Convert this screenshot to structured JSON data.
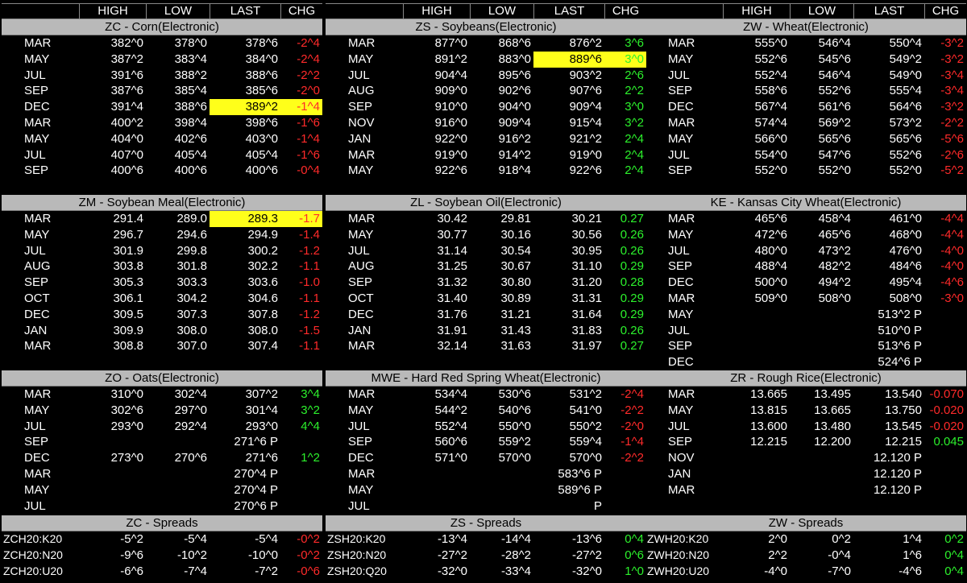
{
  "header": [
    "HIGH",
    "LOW",
    "LAST",
    "CHG"
  ],
  "colors": {
    "up": "#2cf02c",
    "down": "#ff2a2a",
    "highlight": "#ffff1a",
    "title_bg": "#b9b9b9"
  },
  "panels": [
    {
      "title": "ZC - Corn(Electronic)",
      "rows": [
        {
          "m": "MAR",
          "h": "382^0",
          "l": "378^0",
          "last": "378^6",
          "chg": "-2^4",
          "d": "down"
        },
        {
          "m": "MAY",
          "h": "387^2",
          "l": "383^4",
          "last": "384^0",
          "chg": "-2^4",
          "d": "down"
        },
        {
          "m": "JUL",
          "h": "391^6",
          "l": "388^2",
          "last": "388^6",
          "chg": "-2^2",
          "d": "down"
        },
        {
          "m": "SEP",
          "h": "387^6",
          "l": "385^4",
          "last": "385^6",
          "chg": "-2^0",
          "d": "down"
        },
        {
          "m": "DEC",
          "h": "391^4",
          "l": "388^6",
          "last": "389^2",
          "chg": "-1^4",
          "d": "down",
          "hl": true
        },
        {
          "m": "MAR",
          "h": "400^2",
          "l": "398^4",
          "last": "398^6",
          "chg": "-1^6",
          "d": "down"
        },
        {
          "m": "MAY",
          "h": "404^0",
          "l": "402^6",
          "last": "403^0",
          "chg": "-1^4",
          "d": "down"
        },
        {
          "m": "JUL",
          "h": "407^0",
          "l": "405^4",
          "last": "405^4",
          "chg": "-1^6",
          "d": "down"
        },
        {
          "m": "SEP",
          "h": "400^6",
          "l": "400^6",
          "last": "400^6",
          "chg": "-0^4",
          "d": "down"
        }
      ]
    },
    {
      "title": "ZS - Soybeans(Electronic)",
      "rows": [
        {
          "m": "MAR",
          "h": "877^0",
          "l": "868^6",
          "last": "876^2",
          "chg": "3^6",
          "d": "up"
        },
        {
          "m": "MAY",
          "h": "891^2",
          "l": "883^0",
          "last": "889^6",
          "chg": "3^0",
          "d": "up",
          "hl": true
        },
        {
          "m": "JUL",
          "h": "904^4",
          "l": "895^6",
          "last": "903^2",
          "chg": "2^6",
          "d": "up"
        },
        {
          "m": "AUG",
          "h": "909^0",
          "l": "902^6",
          "last": "907^6",
          "chg": "2^2",
          "d": "up"
        },
        {
          "m": "SEP",
          "h": "910^0",
          "l": "904^0",
          "last": "909^4",
          "chg": "3^0",
          "d": "up"
        },
        {
          "m": "NOV",
          "h": "916^0",
          "l": "909^4",
          "last": "915^4",
          "chg": "3^2",
          "d": "up"
        },
        {
          "m": "JAN",
          "h": "922^0",
          "l": "916^2",
          "last": "921^2",
          "chg": "2^4",
          "d": "up"
        },
        {
          "m": "MAR",
          "h": "919^0",
          "l": "914^2",
          "last": "919^0",
          "chg": "2^4",
          "d": "up"
        },
        {
          "m": "MAY",
          "h": "922^6",
          "l": "918^4",
          "last": "922^6",
          "chg": "2^4",
          "d": "up"
        }
      ]
    },
    {
      "title": "ZW - Wheat(Electronic)",
      "rows": [
        {
          "m": "MAR",
          "h": "555^0",
          "l": "546^4",
          "last": "550^4",
          "chg": "-3^2",
          "d": "down"
        },
        {
          "m": "MAY",
          "h": "552^6",
          "l": "545^6",
          "last": "549^2",
          "chg": "-3^2",
          "d": "down"
        },
        {
          "m": "JUL",
          "h": "552^4",
          "l": "546^4",
          "last": "549^0",
          "chg": "-3^4",
          "d": "down"
        },
        {
          "m": "SEP",
          "h": "558^6",
          "l": "552^6",
          "last": "555^4",
          "chg": "-3^4",
          "d": "down"
        },
        {
          "m": "DEC",
          "h": "567^4",
          "l": "561^6",
          "last": "564^6",
          "chg": "-3^2",
          "d": "down"
        },
        {
          "m": "MAR",
          "h": "574^4",
          "l": "569^2",
          "last": "573^2",
          "chg": "-2^2",
          "d": "down"
        },
        {
          "m": "MAY",
          "h": "566^0",
          "l": "565^6",
          "last": "565^6",
          "chg": "-5^6",
          "d": "down"
        },
        {
          "m": "JUL",
          "h": "554^0",
          "l": "547^6",
          "last": "552^6",
          "chg": "-2^6",
          "d": "down"
        },
        {
          "m": "SEP",
          "h": "552^0",
          "l": "552^0",
          "last": "552^0",
          "chg": "-5^2",
          "d": "down"
        }
      ]
    },
    {
      "title": "ZM - Soybean Meal(Electronic)",
      "rows": [
        {
          "m": "MAR",
          "h": "291.4",
          "l": "289.0",
          "last": "289.3",
          "chg": "-1.7",
          "d": "down",
          "hl": true
        },
        {
          "m": "MAY",
          "h": "296.7",
          "l": "294.6",
          "last": "294.9",
          "chg": "-1.4",
          "d": "down"
        },
        {
          "m": "JUL",
          "h": "301.9",
          "l": "299.8",
          "last": "300.2",
          "chg": "-1.2",
          "d": "down"
        },
        {
          "m": "AUG",
          "h": "303.8",
          "l": "301.8",
          "last": "302.2",
          "chg": "-1.1",
          "d": "down"
        },
        {
          "m": "SEP",
          "h": "305.3",
          "l": "303.3",
          "last": "303.6",
          "chg": "-1.0",
          "d": "down"
        },
        {
          "m": "OCT",
          "h": "306.1",
          "l": "304.2",
          "last": "304.6",
          "chg": "-1.1",
          "d": "down"
        },
        {
          "m": "DEC",
          "h": "309.5",
          "l": "307.3",
          "last": "307.8",
          "chg": "-1.2",
          "d": "down"
        },
        {
          "m": "JAN",
          "h": "309.9",
          "l": "308.0",
          "last": "308.0",
          "chg": "-1.5",
          "d": "down"
        },
        {
          "m": "MAR",
          "h": "308.8",
          "l": "307.0",
          "last": "307.4",
          "chg": "-1.1",
          "d": "down"
        }
      ]
    },
    {
      "title": "ZL - Soybean Oil(Electronic)",
      "rows": [
        {
          "m": "MAR",
          "h": "30.42",
          "l": "29.81",
          "last": "30.21",
          "chg": "0.27",
          "d": "up"
        },
        {
          "m": "MAY",
          "h": "30.77",
          "l": "30.16",
          "last": "30.56",
          "chg": "0.26",
          "d": "up"
        },
        {
          "m": "JUL",
          "h": "31.14",
          "l": "30.54",
          "last": "30.95",
          "chg": "0.26",
          "d": "up"
        },
        {
          "m": "AUG",
          "h": "31.25",
          "l": "30.67",
          "last": "31.10",
          "chg": "0.29",
          "d": "up"
        },
        {
          "m": "SEP",
          "h": "31.32",
          "l": "30.80",
          "last": "31.20",
          "chg": "0.28",
          "d": "up"
        },
        {
          "m": "OCT",
          "h": "31.40",
          "l": "30.89",
          "last": "31.31",
          "chg": "0.29",
          "d": "up"
        },
        {
          "m": "DEC",
          "h": "31.76",
          "l": "31.21",
          "last": "31.64",
          "chg": "0.29",
          "d": "up"
        },
        {
          "m": "JAN",
          "h": "31.91",
          "l": "31.43",
          "last": "31.83",
          "chg": "0.26",
          "d": "up"
        },
        {
          "m": "MAR",
          "h": "32.14",
          "l": "31.63",
          "last": "31.97",
          "chg": "0.27",
          "d": "up"
        }
      ]
    },
    {
      "title": "KE - Kansas City Wheat(Electronic)",
      "rows": [
        {
          "m": "MAR",
          "h": "465^6",
          "l": "458^4",
          "last": "461^0",
          "chg": "-4^4",
          "d": "down"
        },
        {
          "m": "MAY",
          "h": "472^6",
          "l": "465^6",
          "last": "468^0",
          "chg": "-4^4",
          "d": "down"
        },
        {
          "m": "JUL",
          "h": "480^0",
          "l": "473^2",
          "last": "476^0",
          "chg": "-4^0",
          "d": "down"
        },
        {
          "m": "SEP",
          "h": "488^4",
          "l": "482^2",
          "last": "484^6",
          "chg": "-4^0",
          "d": "down"
        },
        {
          "m": "DEC",
          "h": "500^0",
          "l": "494^2",
          "last": "495^4",
          "chg": "-4^6",
          "d": "down"
        },
        {
          "m": "MAR",
          "h": "509^0",
          "l": "508^0",
          "last": "508^0",
          "chg": "-3^0",
          "d": "down"
        },
        {
          "m": "MAY",
          "h": "",
          "l": "",
          "last": "513^2 P",
          "chg": "",
          "d": ""
        },
        {
          "m": "JUL",
          "h": "",
          "l": "",
          "last": "510^0 P",
          "chg": "",
          "d": ""
        },
        {
          "m": "SEP",
          "h": "",
          "l": "",
          "last": "513^6 P",
          "chg": "",
          "d": ""
        },
        {
          "m": "DEC",
          "h": "",
          "l": "",
          "last": "524^6 P",
          "chg": "",
          "d": ""
        }
      ]
    },
    {
      "title": "ZO - Oats(Electronic)",
      "rows": [
        {
          "m": "MAR",
          "h": "310^0",
          "l": "302^4",
          "last": "307^2",
          "chg": "3^4",
          "d": "up"
        },
        {
          "m": "MAY",
          "h": "302^6",
          "l": "297^0",
          "last": "301^4",
          "chg": "3^2",
          "d": "up"
        },
        {
          "m": "JUL",
          "h": "293^0",
          "l": "292^4",
          "last": "293^0",
          "chg": "4^4",
          "d": "up"
        },
        {
          "m": "SEP",
          "h": "",
          "l": "",
          "last": "271^6 P",
          "chg": "",
          "d": ""
        },
        {
          "m": "DEC",
          "h": "273^0",
          "l": "270^6",
          "last": "271^6",
          "chg": "1^2",
          "d": "up"
        },
        {
          "m": "MAR",
          "h": "",
          "l": "",
          "last": "270^4 P",
          "chg": "",
          "d": ""
        },
        {
          "m": "MAY",
          "h": "",
          "l": "",
          "last": "270^4 P",
          "chg": "",
          "d": ""
        },
        {
          "m": "JUL",
          "h": "",
          "l": "",
          "last": "270^6 P",
          "chg": "",
          "d": ""
        }
      ]
    },
    {
      "title": "MWE - Hard Red Spring Wheat(Electronic)",
      "rows": [
        {
          "m": "MAR",
          "h": "534^4",
          "l": "530^6",
          "last": "531^2",
          "chg": "-2^4",
          "d": "down"
        },
        {
          "m": "MAY",
          "h": "544^2",
          "l": "540^6",
          "last": "541^0",
          "chg": "-2^2",
          "d": "down"
        },
        {
          "m": "JUL",
          "h": "552^4",
          "l": "550^0",
          "last": "550^2",
          "chg": "-2^0",
          "d": "down"
        },
        {
          "m": "SEP",
          "h": "560^6",
          "l": "559^2",
          "last": "559^4",
          "chg": "-1^4",
          "d": "down"
        },
        {
          "m": "DEC",
          "h": "571^0",
          "l": "570^0",
          "last": "570^0",
          "chg": "-2^2",
          "d": "down"
        },
        {
          "m": "MAR",
          "h": "",
          "l": "",
          "last": "583^6 P",
          "chg": "",
          "d": ""
        },
        {
          "m": "MAY",
          "h": "",
          "l": "",
          "last": "589^6 P",
          "chg": "",
          "d": ""
        },
        {
          "m": "JUL",
          "h": "",
          "l": "",
          "last": "P",
          "chg": "",
          "d": ""
        }
      ]
    },
    {
      "title": "ZR - Rough Rice(Electronic)",
      "rows": [
        {
          "m": "MAR",
          "h": "13.665",
          "l": "13.495",
          "last": "13.540",
          "chg": "-0.070",
          "d": "down"
        },
        {
          "m": "MAY",
          "h": "13.815",
          "l": "13.665",
          "last": "13.750",
          "chg": "-0.020",
          "d": "down"
        },
        {
          "m": "JUL",
          "h": "13.600",
          "l": "13.480",
          "last": "13.545",
          "chg": "-0.020",
          "d": "down"
        },
        {
          "m": "SEP",
          "h": "12.215",
          "l": "12.200",
          "last": "12.215",
          "chg": "0.045",
          "d": "up"
        },
        {
          "m": "NOV",
          "h": "",
          "l": "",
          "last": "12.120 P",
          "chg": "",
          "d": ""
        },
        {
          "m": "JAN",
          "h": "",
          "l": "",
          "last": "12.120 P",
          "chg": "",
          "d": ""
        },
        {
          "m": "MAR",
          "h": "",
          "l": "",
          "last": "12.120 P",
          "chg": "",
          "d": ""
        }
      ]
    },
    {
      "title": "ZC - Spreads",
      "spread": true,
      "rows": [
        {
          "m": "ZCH20:K20",
          "h": "-5^2",
          "l": "-5^4",
          "last": "-5^4",
          "chg": "-0^2",
          "d": "down"
        },
        {
          "m": "ZCH20:N20",
          "h": "-9^6",
          "l": "-10^2",
          "last": "-10^0",
          "chg": "-0^2",
          "d": "down"
        },
        {
          "m": "ZCH20:U20",
          "h": "-6^6",
          "l": "-7^4",
          "last": "-7^2",
          "chg": "-0^6",
          "d": "down"
        }
      ]
    },
    {
      "title": "ZS - Spreads",
      "spread": true,
      "rows": [
        {
          "m": "ZSH20:K20",
          "h": "-13^4",
          "l": "-14^4",
          "last": "-13^6",
          "chg": "0^4",
          "d": "up"
        },
        {
          "m": "ZSH20:N20",
          "h": "-27^2",
          "l": "-28^2",
          "last": "-27^2",
          "chg": "0^6",
          "d": "up"
        },
        {
          "m": "ZSH20:Q20",
          "h": "-32^0",
          "l": "-33^4",
          "last": "-32^0",
          "chg": "1^0",
          "d": "up"
        }
      ]
    },
    {
      "title": "ZW - Spreads",
      "spread": true,
      "rows": [
        {
          "m": "ZWH20:K20",
          "h": "2^0",
          "l": "0^2",
          "last": "1^4",
          "chg": "0^2",
          "d": "up"
        },
        {
          "m": "ZWH20:N20",
          "h": "2^2",
          "l": "-0^4",
          "last": "1^6",
          "chg": "0^4",
          "d": "up"
        },
        {
          "m": "ZWH20:U20",
          "h": "-4^0",
          "l": "-7^0",
          "last": "-4^6",
          "chg": "0^4",
          "d": "up"
        }
      ]
    }
  ]
}
